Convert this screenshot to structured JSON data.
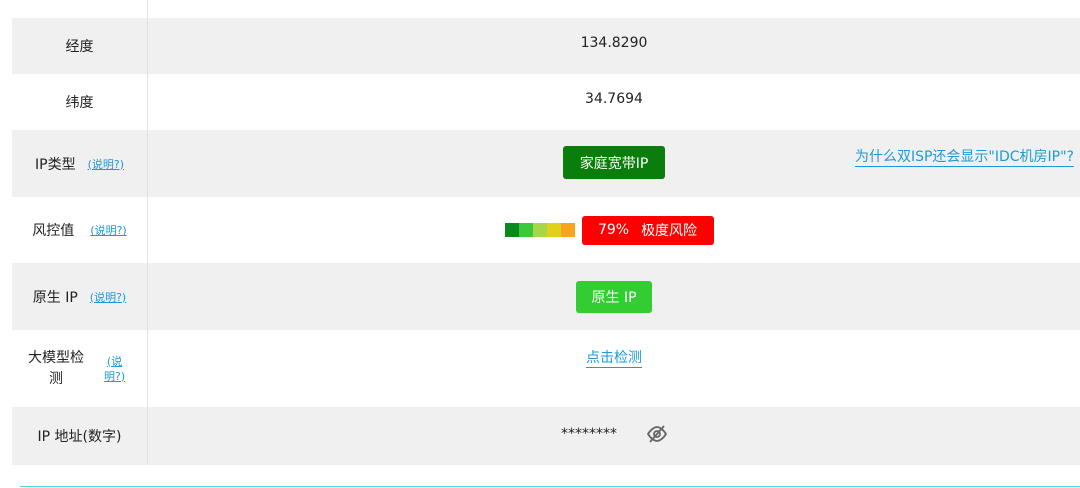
{
  "rows": {
    "longitude": {
      "label": "经度",
      "value": "134.8290"
    },
    "latitude": {
      "label": "纬度",
      "value": "34.7694"
    },
    "ip_type": {
      "label": "IP类型",
      "help": "(说明?)",
      "badge": "家庭宽带IP",
      "aside_link": "为什么双ISP还会显示\"IDC机房IP\"?"
    },
    "risk": {
      "label": "风控值",
      "help": "(说明?)",
      "score_percent": 79,
      "score_text": "79%",
      "level": "极度风险",
      "scale_colors": [
        "#0a8a1a",
        "#3cc83c",
        "#a8d64a",
        "#e0d21a",
        "#f7a51c"
      ]
    },
    "native_ip": {
      "label": "原生 IP",
      "help": "(说明?)",
      "badge": "原生 IP"
    },
    "llm_check": {
      "label_line1": "大模型检",
      "label_line2": "测",
      "help_line1": "(说",
      "help_line2": "明?)",
      "link": "点击检测"
    },
    "ip_numeric": {
      "label": "IP 地址(数字)",
      "value": "********",
      "icon": "eye-off-icon"
    }
  },
  "colors": {
    "badge_green_dark": "#0a7d0a",
    "badge_green_light": "#33cc33",
    "badge_red": "#ff0000",
    "link_blue": "#1a9bd7"
  }
}
